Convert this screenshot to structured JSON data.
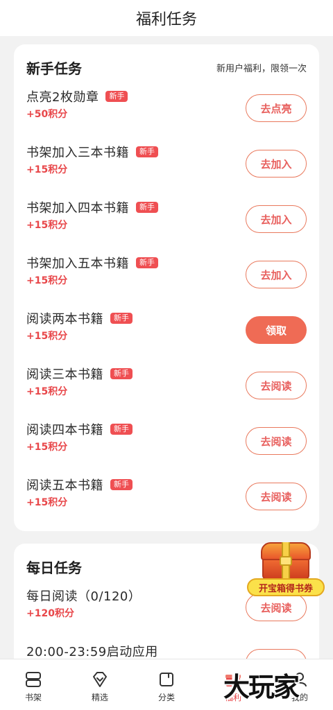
{
  "header": {
    "title": "福利任务"
  },
  "newbie": {
    "title": "新手任务",
    "note": "新用户福利，限领一次",
    "tasks": [
      {
        "name": "点亮2枚勋章",
        "badge": "新手",
        "points": "+50积分",
        "action": "去点亮",
        "filled": false
      },
      {
        "name": "书架加入三本书籍",
        "badge": "新手",
        "points": "+15积分",
        "action": "去加入",
        "filled": false
      },
      {
        "name": "书架加入四本书籍",
        "badge": "新手",
        "points": "+15积分",
        "action": "去加入",
        "filled": false
      },
      {
        "name": "书架加入五本书籍",
        "badge": "新手",
        "points": "+15积分",
        "action": "去加入",
        "filled": false
      },
      {
        "name": "阅读两本书籍",
        "badge": "新手",
        "points": "+15积分",
        "action": "领取",
        "filled": true
      },
      {
        "name": "阅读三本书籍",
        "badge": "新手",
        "points": "+15积分",
        "action": "去阅读",
        "filled": false
      },
      {
        "name": "阅读四本书籍",
        "badge": "新手",
        "points": "+15积分",
        "action": "去阅读",
        "filled": false
      },
      {
        "name": "阅读五本书籍",
        "badge": "新手",
        "points": "+15积分",
        "action": "去阅读",
        "filled": false
      }
    ]
  },
  "daily": {
    "title": "每日任务",
    "tasks": [
      {
        "name": "每日阅读（0/120）",
        "points": "+120积分",
        "action": "去阅读"
      },
      {
        "name": "20:00-23:59启动应用",
        "points": "",
        "action": ""
      }
    ]
  },
  "promo": {
    "label": "开宝箱得书券"
  },
  "tabbar": {
    "items": [
      {
        "label": "书架",
        "icon": "bookshelf-icon"
      },
      {
        "label": "精选",
        "icon": "diamond-icon"
      },
      {
        "label": "分类",
        "icon": "category-icon"
      },
      {
        "label": "福利",
        "icon": "gift-icon"
      },
      {
        "label": "我的",
        "icon": "profile-icon"
      }
    ],
    "active_index": 3
  },
  "watermark": {
    "text": "大玩家"
  },
  "colors": {
    "accent": "#e8474a",
    "button_border": "#e9785c",
    "button_filled": "#ef6b55",
    "badge": "#ef4f52"
  }
}
